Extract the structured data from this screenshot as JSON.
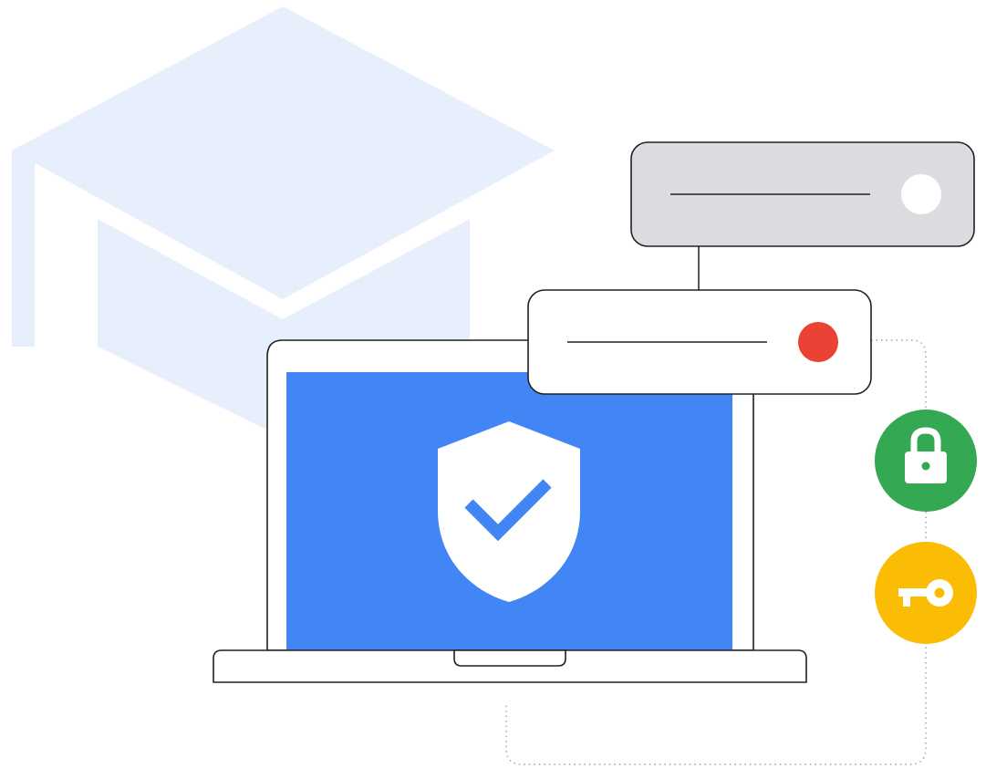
{
  "illustration": {
    "colors": {
      "cap": "#e8effc",
      "screen": "#4285f4",
      "shield": "#ffffff",
      "check": "#4285f4",
      "outline": "#202124",
      "panel_gray": "#dadce0",
      "panel_white": "#ffffff",
      "dot_white": "#ffffff",
      "dot_red": "#ea4335",
      "lock_badge": "#34a853",
      "key_badge": "#fbbc04",
      "connector": "#9aa0a6"
    },
    "icons": {
      "cap": "graduation-cap-icon",
      "laptop": "laptop-icon",
      "shield": "shield-check-icon",
      "lock": "lock-icon",
      "key": "key-icon"
    }
  }
}
